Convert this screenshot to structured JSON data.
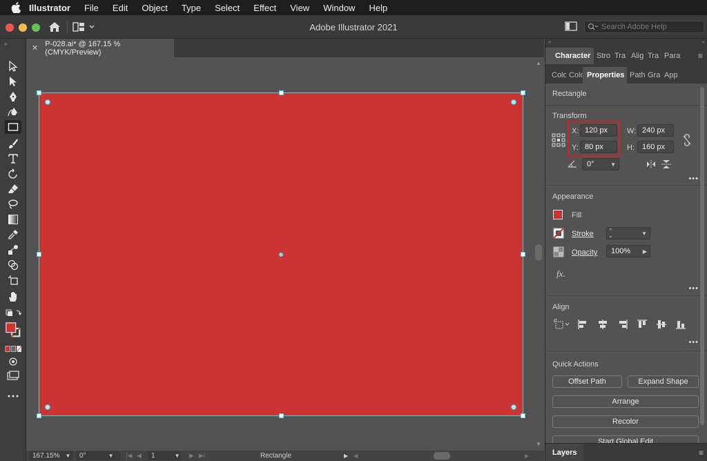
{
  "menubar": {
    "items": [
      "Illustrator",
      "File",
      "Edit",
      "Object",
      "Type",
      "Select",
      "Effect",
      "View",
      "Window",
      "Help"
    ]
  },
  "titlebar": {
    "title": "Adobe Illustrator 2021",
    "search_placeholder": "Search Adobe Help"
  },
  "document": {
    "tab_label": "P-028.ai* @ 167.15 % (CMYK/Preview)",
    "fill_color": "#cc3333",
    "selection_color": "#4fd2e0"
  },
  "statusbar": {
    "zoom": "167.15%",
    "rotation": "0°",
    "artboard_number": "1",
    "selection": "Rectangle"
  },
  "panel": {
    "tabs_row1": [
      "Character",
      "Stro",
      "Tra",
      "Alig",
      "Tra",
      "Para"
    ],
    "tabs_row2": [
      "Colo",
      "Colo",
      "Properties",
      "Path",
      "Gra",
      "App"
    ],
    "object_type": "Rectangle",
    "transform": {
      "label": "Transform",
      "x_label": "X:",
      "x": "120 px",
      "y_label": "Y:",
      "y": "80 px",
      "w_label": "W:",
      "w": "240 px",
      "h_label": "H:",
      "h": "160 px",
      "angle": "0°"
    },
    "appearance": {
      "label": "Appearance",
      "fill_label": "Fill",
      "stroke_label": "Stroke",
      "opacity_label": "Opacity",
      "opacity": "100%",
      "fx_label": "fx."
    },
    "align": {
      "label": "Align"
    },
    "quick_actions": {
      "label": "Quick Actions",
      "offset_path": "Offset Path",
      "expand_shape": "Expand Shape",
      "arrange": "Arrange",
      "recolor": "Recolor",
      "start_global_edit": "Start Global Edit"
    },
    "layers_label": "Layers"
  }
}
